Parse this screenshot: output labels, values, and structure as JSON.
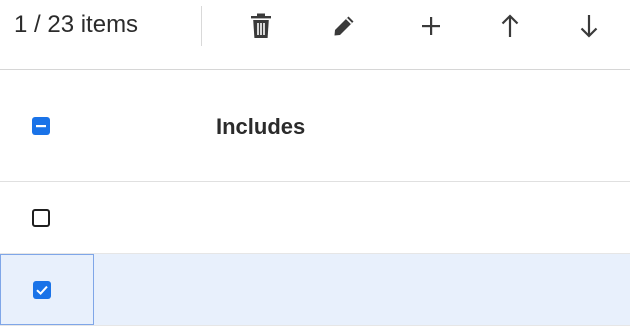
{
  "toolbar": {
    "item_count": "1 / 23 items",
    "actions": [
      {
        "name": "delete",
        "icon": "trash-icon"
      },
      {
        "name": "edit",
        "icon": "pencil-icon"
      },
      {
        "name": "add",
        "icon": "plus-icon"
      },
      {
        "name": "move-up",
        "icon": "arrow-up-icon"
      },
      {
        "name": "move-down",
        "icon": "arrow-down-icon"
      }
    ]
  },
  "table": {
    "header": {
      "select_all_state": "indeterminate",
      "columns": [
        "Includes"
      ]
    },
    "rows": [
      {
        "selected": false,
        "checked": false,
        "includes": ""
      },
      {
        "selected": true,
        "checked": true,
        "includes": ""
      }
    ]
  },
  "colors": {
    "accent": "#1a73e8",
    "selected_row_bg": "#e8f0fc",
    "selected_cell_border": "#7fa6e8",
    "icon": "#3a3a3a"
  }
}
